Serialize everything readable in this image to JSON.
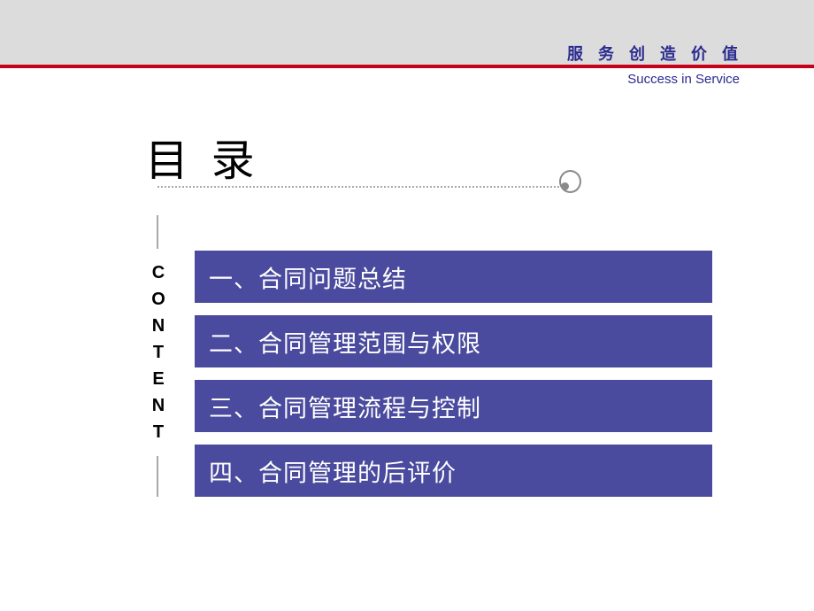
{
  "header": {
    "brand_cn": "服 务 创 造 价 值",
    "brand_en": "Success in Service",
    "band_color": "#dcdcdc",
    "rule_color": "#c80019",
    "text_color": "#2b2b8f"
  },
  "title": {
    "text": "目  录",
    "decor_line_color": "#8c8c8c",
    "decor_circle_color": "#8a8a8a"
  },
  "rail": {
    "letters": [
      "C",
      "O",
      "N",
      "T",
      "E",
      "N",
      "T"
    ],
    "line_color": "#a9a9a9"
  },
  "content": {
    "accent_color": "#4a4a9e",
    "text_color": "#ffffff",
    "items": [
      {
        "label": "一、合同问题总结"
      },
      {
        "label": "二、合同管理范围与权限"
      },
      {
        "label": "三、合同管理流程与控制"
      },
      {
        "label": "四、合同管理的后评价"
      }
    ]
  }
}
